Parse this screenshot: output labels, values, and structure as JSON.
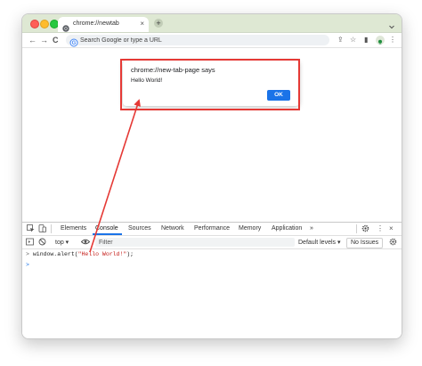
{
  "browser": {
    "tab": {
      "title": "chrome://newtab",
      "favicon_icon": "chrome-logo-icon",
      "close_glyph": "×"
    },
    "new_tab_glyph": "+",
    "tabbar_menu_icon": "chevron-down-icon",
    "nav": {
      "back_glyph": "←",
      "forward_glyph": "→",
      "reload_glyph": "C"
    },
    "omnibox": {
      "placeholder": "Search Google or type a URL",
      "value": ""
    },
    "toolbar_icons": {
      "share_glyph": "⇪",
      "star_glyph": "☆",
      "sidepanel_glyph": "▮",
      "menu_glyph": "⋮"
    }
  },
  "alert": {
    "title": "chrome://new-tab-page says",
    "message": "Hello World!",
    "ok_label": "OK"
  },
  "highlight_color": "#e53935",
  "devtools": {
    "tabs": [
      "Elements",
      "Console",
      "Sources",
      "Network",
      "Performance",
      "Memory",
      "Application"
    ],
    "active_tab": "Console",
    "more_tabs_glyph": "»",
    "menu_glyph": "⋮",
    "close_glyph": "×",
    "context": "top ▾",
    "filter_placeholder": "Filter",
    "levels": "Default levels ▾",
    "issues": "No Issues",
    "console": {
      "prompt_glyph": ">",
      "call": "window.alert(",
      "argument": "\"Hello World!\"",
      "call_end": ");",
      "input_prompt": ">"
    }
  },
  "colors": {
    "tabbar_bg": "#dee8d3",
    "accent_blue": "#1a73e8",
    "arrow_red": "#e53935",
    "string_red": "#c41a16"
  }
}
